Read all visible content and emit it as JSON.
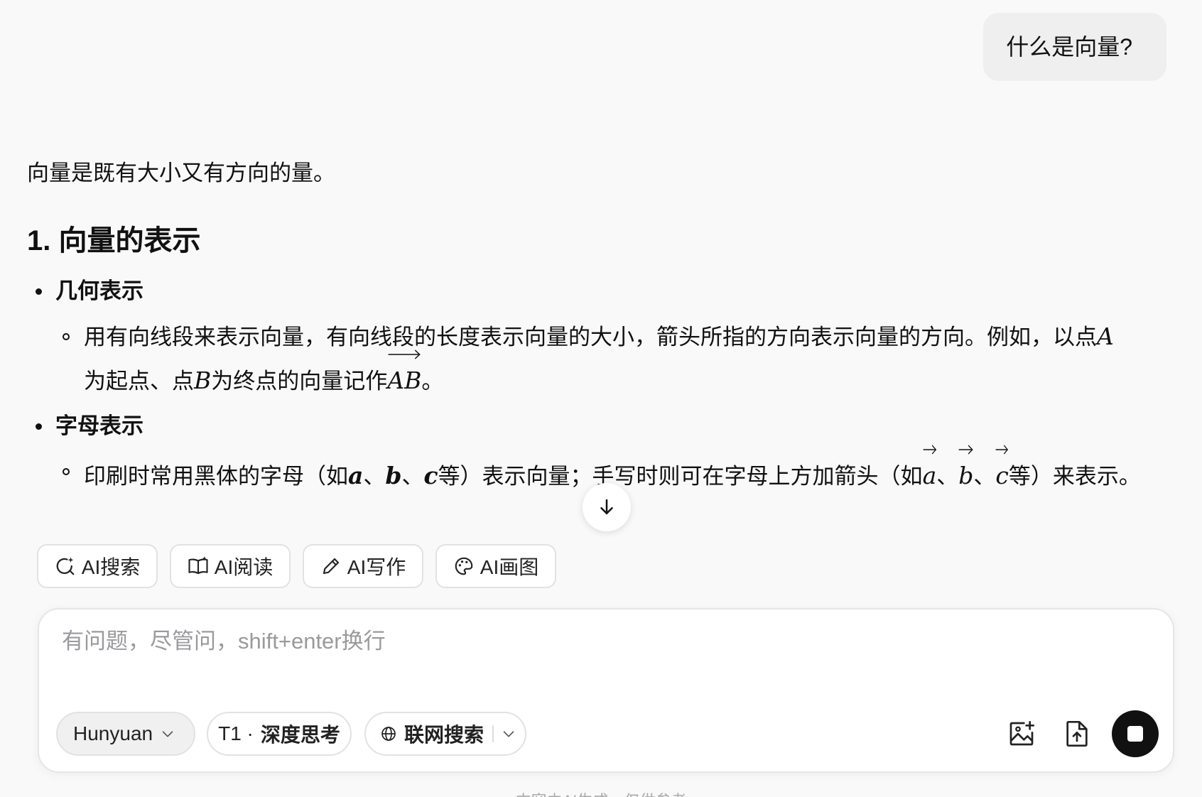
{
  "conversation": {
    "user_message": "什么是向量?",
    "answer": {
      "intro": "向量是既有大小又有方向的量。",
      "section_heading": "1. 向量的表示",
      "bullets": [
        {
          "title": "几何表示",
          "text_1": "用有向线段来表示向量，有向线段的长度表示向量的大小，箭头所指的方向表示向量的方向。例如，以点",
          "math_a": "A",
          "text_2": "为起点、点",
          "math_b": "B",
          "text_3": "为终点的向量记作",
          "math_ab": "AB",
          "text_4": "。"
        },
        {
          "title": "字母表示",
          "text_1": "印刷时常用黑体的字母（如",
          "bold_a": "a",
          "sep_1": "、",
          "bold_b": "b",
          "sep_2": "、",
          "bold_c": "c",
          "text_2": "等）表示向量；手写时则可在字母上方加箭头（如",
          "vec_a": "a",
          "sep_3": "、",
          "vec_b": "b",
          "sep_4": "、",
          "vec_c": "c",
          "text_3": "等）来表示。"
        }
      ]
    }
  },
  "tools": {
    "search": "AI搜索",
    "read": "AI阅读",
    "write": "AI写作",
    "draw": "AI画图"
  },
  "composer": {
    "placeholder": "有问题，尽管问，shift+enter换行",
    "model": "Hunyuan",
    "think_prefix": "T1 ·",
    "think_label": "深度思考",
    "web_search": "联网搜索"
  },
  "footer": "内容由AI生成，仅供参考",
  "icons": {
    "scroll": "arrow-down-icon",
    "search": "search-sparkle-icon",
    "read": "book-icon",
    "write": "pen-icon",
    "draw": "palette-icon",
    "model": "chevron-down-icon",
    "web": "globe-icon",
    "image": "image-add-icon",
    "upload": "upload-file-icon",
    "stop": "stop-icon"
  }
}
